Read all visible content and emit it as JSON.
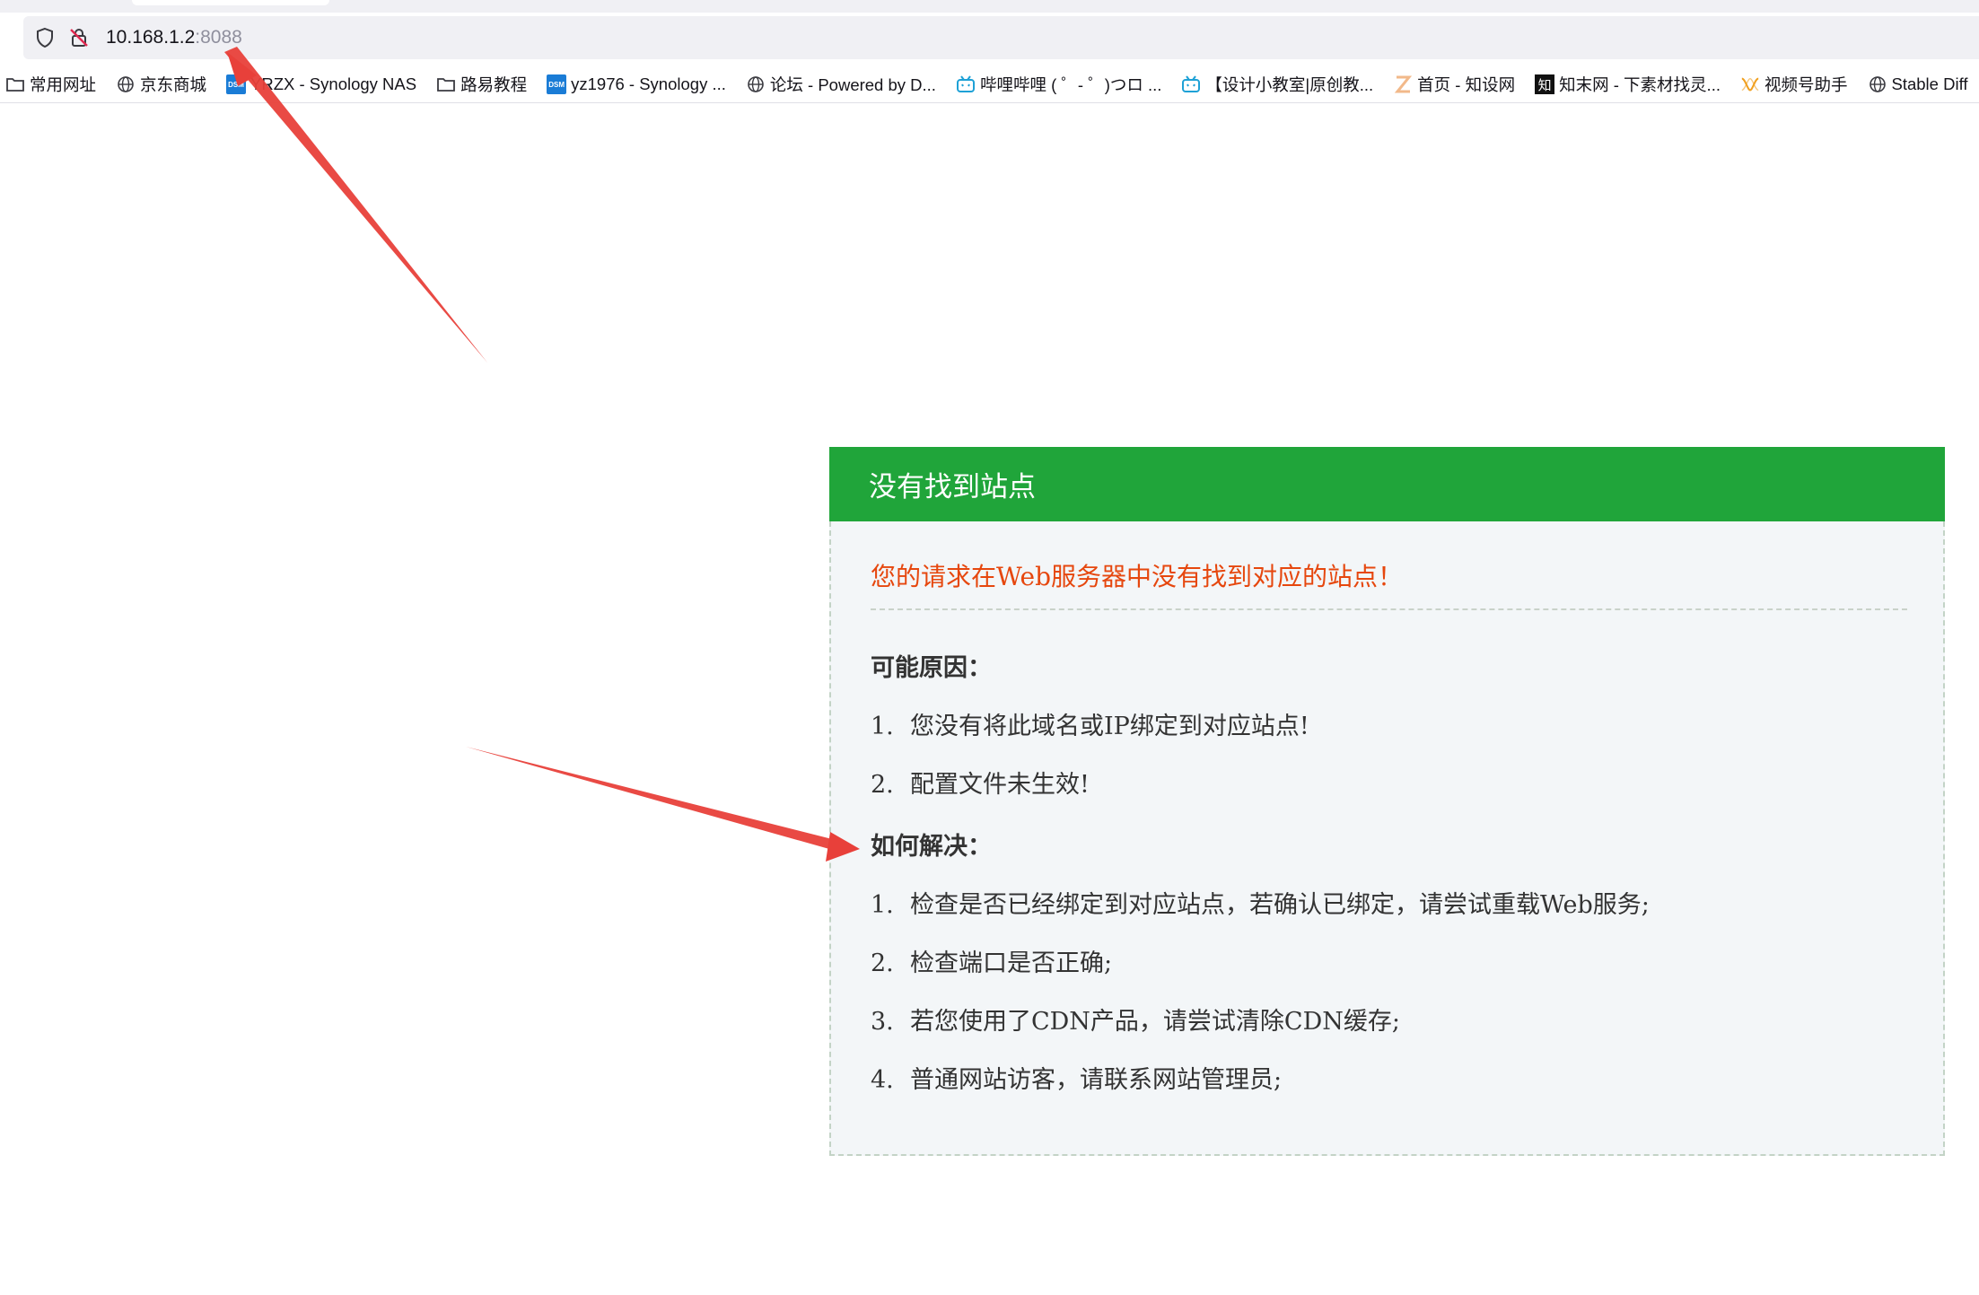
{
  "browser": {
    "url_host": "10.168.1.2",
    "url_port": ":8088",
    "icons": [
      "shield-icon",
      "insecure-lock-icon"
    ],
    "bookmarks": [
      {
        "label": "常用网址",
        "icon": "folder-icon"
      },
      {
        "label": "京东商城",
        "icon": "globe-icon"
      },
      {
        "label": "YRZX - Synology NAS",
        "icon": "dsm-icon"
      },
      {
        "label": "路易教程",
        "icon": "folder-icon"
      },
      {
        "label": "yz1976 - Synology ...",
        "icon": "dsm-icon"
      },
      {
        "label": "论坛 - Powered by D...",
        "icon": "globe-icon"
      },
      {
        "label": "哔哩哔哩 ( ゜- ゜)つロ ...",
        "icon": "bilibili-icon"
      },
      {
        "label": "【设计小教室|原创教...",
        "icon": "bilibili-icon"
      },
      {
        "label": "首页 - 知设网",
        "icon": "zhishe-icon"
      },
      {
        "label": "知末网 - 下素材找灵...",
        "icon": "zhimo-icon"
      },
      {
        "label": "视频号助手",
        "icon": "channels-icon"
      },
      {
        "label": "Stable Diff",
        "icon": "globe-icon"
      }
    ],
    "dsm_text": "DSM",
    "zhi_text": "知"
  },
  "page": {
    "header_title": "没有找到站点",
    "headline": "您的请求在Web服务器中没有找到对应的站点！",
    "reasons_title": "可能原因：",
    "reasons": [
      {
        "num": "1.",
        "text": "您没有将此域名或IP绑定到对应站点!"
      },
      {
        "num": "2.",
        "text": "配置文件未生效!"
      }
    ],
    "solutions_title": "如何解决：",
    "solutions": [
      {
        "num": "1.",
        "text": "检查是否已经绑定到对应站点，若确认已绑定，请尝试重载Web服务;"
      },
      {
        "num": "2.",
        "text": "检查端口是否正确;"
      },
      {
        "num": "3.",
        "text": "若您使用了CDN产品，请尝试清除CDN缓存;"
      },
      {
        "num": "4.",
        "text": "普通网站访客，请联系网站管理员;"
      }
    ]
  },
  "colors": {
    "header_green": "#20a53a",
    "headline_orange": "#e6470e",
    "arrow_red": "#e8403a"
  }
}
